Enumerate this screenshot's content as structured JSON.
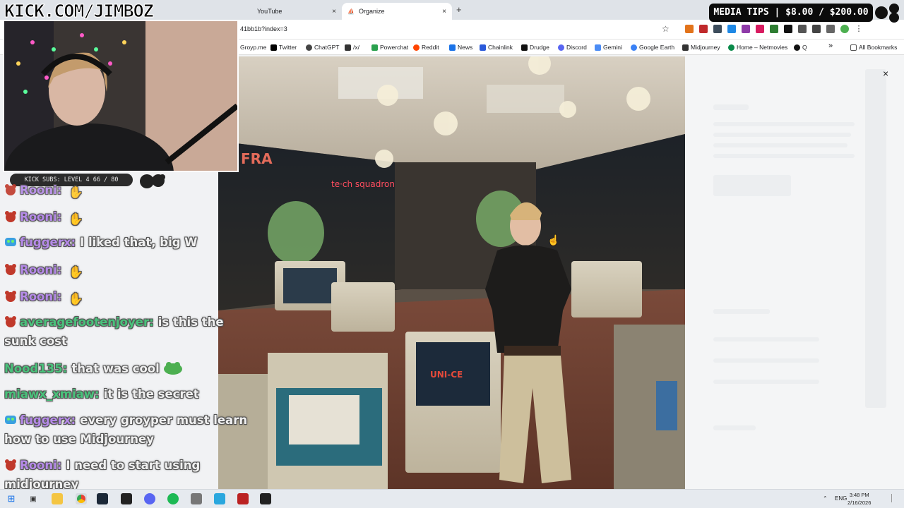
{
  "browser": {
    "tabs": [
      {
        "label": "YouTube",
        "close": "×"
      },
      {
        "label": "Organize",
        "close": "×"
      }
    ],
    "new_tab": "+",
    "url": "41bb1b?index=3",
    "star": "☆",
    "bookmarks": [
      {
        "label": "Groyp.me",
        "color": "#7a7a7a"
      },
      {
        "label": "Twitter",
        "color": "#000000"
      },
      {
        "label": "ChatGPT",
        "color": "#444444"
      },
      {
        "label": "/x/",
        "color": "#333333"
      },
      {
        "label": "Powerchat",
        "color": "#2aa14e"
      },
      {
        "label": "Reddit",
        "color": "#ff4500"
      },
      {
        "label": "News",
        "color": "#1a73e8"
      },
      {
        "label": "Chainlink",
        "color": "#2a5ada"
      },
      {
        "label": "Drudge",
        "color": "#111111"
      },
      {
        "label": "Discord",
        "color": "#5865f2"
      },
      {
        "label": "Gemini",
        "color": "#4b8cf5"
      },
      {
        "label": "Google Earth",
        "color": "#3b82f6"
      },
      {
        "label": "Midjourney",
        "color": "#333333"
      },
      {
        "label": "Home – Netmovies",
        "color": "#0a8a4a"
      },
      {
        "label": "Q",
        "color": "#111111"
      }
    ],
    "more_bookmarks": "»",
    "all_bookmarks": "All Bookmarks"
  },
  "overlay": {
    "watermark": "KICK.COM/JIMBOZ",
    "subs_bar": "KICK SUBS: LEVEL 4 66 / 80",
    "media_tips": "MEDIA TIPS | $8.00 / $200.00"
  },
  "lightbox": {
    "close": "×"
  },
  "chat": [
    {
      "user": "Rooni:",
      "text": "",
      "color": "#b58ae8",
      "badge": "bear"
    },
    {
      "user": "Rooni:",
      "text": "",
      "color": "#b58ae8",
      "badge": "bear"
    },
    {
      "user": "fuggerx:",
      "text": "I liked that, big W",
      "color": "#b58ae8",
      "badge": "frog"
    },
    {
      "user": "Rooni:",
      "text": "",
      "color": "#b58ae8",
      "badge": "bear"
    },
    {
      "user": "Rooni:",
      "text": "",
      "color": "#b58ae8",
      "badge": "bear"
    },
    {
      "user": "averagefootenjoyer:",
      "text": "is this the sunk cost",
      "color": "#49c27b",
      "badge": "bear"
    },
    {
      "user": "Nood135:",
      "text": "that was cool",
      "color": "#49c27b",
      "badge": ""
    },
    {
      "user": "miawx_xmiaw:",
      "text": "it is the secret",
      "color": "#49c27b",
      "badge": ""
    },
    {
      "user": "fuggerx:",
      "text": "every groyper must learn how to use Midjourney",
      "color": "#b58ae8",
      "badge": "frog"
    },
    {
      "user": "Rooni:",
      "text": "I need to start using midjourney",
      "color": "#b58ae8",
      "badge": "bear"
    }
  ],
  "taskbar": {
    "lang": "ENG",
    "time": "3:48 PM",
    "date": "2/16/2026"
  }
}
